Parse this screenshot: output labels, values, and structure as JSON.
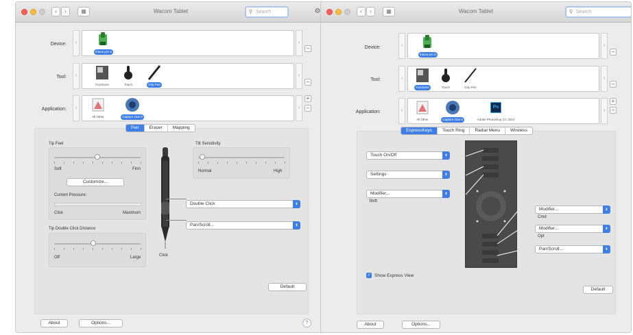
{
  "left": {
    "title": "Wacom Tablet",
    "search_placeholder": "Search",
    "device": {
      "label": "Device:",
      "item": "Intuos pro S"
    },
    "tool": {
      "label": "Tool:",
      "items": [
        "Functions",
        "Touch",
        "Grip Pen"
      ],
      "selected": "Grip Pen"
    },
    "application": {
      "label": "Application:",
      "items": [
        "All Other",
        "Capture One 8"
      ],
      "selected": "Capture One 8"
    },
    "tabs": [
      "Pen",
      "Eraser",
      "Mapping"
    ],
    "active_tab": "Pen",
    "tip_feel": {
      "title": "Tip Feel",
      "min": "Soft",
      "max": "Firm",
      "level": 0.5,
      "customize": "Customize...",
      "pressure_label": "Current Pressure:",
      "pressure_min": "Click",
      "pressure_max": "Maximum"
    },
    "double_click": {
      "title": "Tip Double Click Distance",
      "min": "Off",
      "max": "Large",
      "level": 0.45
    },
    "tilt": {
      "title": "Tilt Sensitivity",
      "min": "Normal",
      "max": "High",
      "level": 0.05
    },
    "pen_buttons": [
      "Double Click",
      "Pan/Scroll..."
    ],
    "tip_label": "Click",
    "default": "Default",
    "about": "About",
    "options": "Options...",
    "help": "?"
  },
  "right": {
    "title": "Wacom Tablet",
    "search_placeholder": "Search",
    "device": {
      "label": "Device:",
      "item": "Intuos pro S"
    },
    "tool": {
      "label": "Tool:",
      "items": [
        "Functions",
        "Touch",
        "Grip Pen"
      ],
      "selected": "Functions"
    },
    "application": {
      "label": "Application:",
      "items": [
        "All Other",
        "Capture One 8",
        "Adobe Photoshop CC 2014"
      ],
      "selected": "Capture One 8"
    },
    "ps_glyph": "Ps",
    "tabs": [
      "ExpressKeys",
      "Touch Ring",
      "Radial Menu",
      "Wireless"
    ],
    "active_tab": "ExpressKeys",
    "left_keys": [
      {
        "value": "Touch On/Off",
        "sub": ""
      },
      {
        "value": "Settings",
        "sub": ""
      },
      {
        "value": "Modifier...",
        "sub": "Shift"
      }
    ],
    "right_keys": [
      {
        "value": "Modifier...",
        "sub": "Cmd"
      },
      {
        "value": "Modifier...",
        "sub": "Opt"
      },
      {
        "value": "Pan/Scroll...",
        "sub": ""
      }
    ],
    "show_express_view": "Show Express View",
    "show_express_view_checked": true,
    "default": "Default",
    "about": "About",
    "options": "Options...",
    "help": "?"
  }
}
